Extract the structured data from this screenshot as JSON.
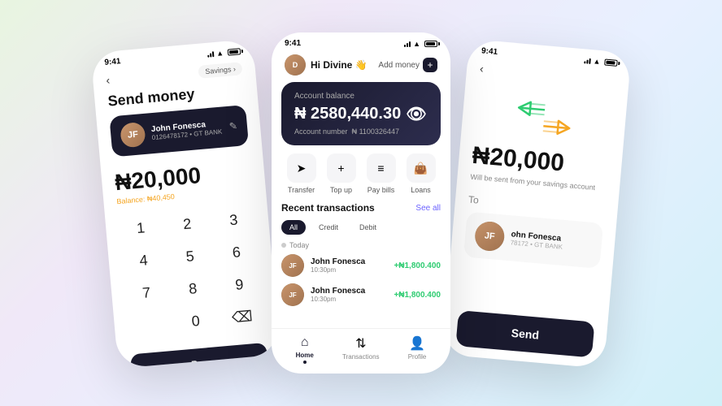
{
  "left_phone": {
    "status_time": "9:41",
    "header": {
      "back": "‹",
      "savings": "Savings ›"
    },
    "title": "Send money",
    "recipient": {
      "name": "John Fonesca",
      "account": "0126478172 • GT BANK",
      "initials": "JF"
    },
    "amount": "₦20,000",
    "balance": "Balance: ₦40,450",
    "numpad": [
      "1",
      "2",
      "3",
      "4",
      "5",
      "6",
      "7",
      "8",
      "9",
      "",
      "0",
      "⌫"
    ],
    "bottom_btn": "Pro"
  },
  "mid_phone": {
    "status_time": "9:41",
    "header": {
      "greeting": "Hi Divine 👋",
      "add_money": "Add money",
      "user_initials": "D"
    },
    "balance_card": {
      "label": "Account balance",
      "amount": "₦ 2580,440.30",
      "eye_icon": "👁",
      "account_label": "Account number",
      "account_number": "₦ 1100326447"
    },
    "actions": [
      {
        "icon": "➤",
        "label": "Transfer"
      },
      {
        "icon": "+",
        "label": "Top up"
      },
      {
        "icon": "≡",
        "label": "Pay bills"
      },
      {
        "icon": "👜",
        "label": "Loans"
      }
    ],
    "transactions": {
      "title": "Recent transactions",
      "see_all": "See all",
      "filters": [
        "All",
        "Credit",
        "Debit"
      ],
      "active_filter": "All",
      "date_label": "Today",
      "items": [
        {
          "name": "John Fonesca",
          "time": "10:30pm",
          "amount": "+₦1,800.400",
          "initials": "JF"
        },
        {
          "name": "John Fonesca",
          "time": "10:30pm",
          "amount": "+₦1,800.400",
          "initials": "JF"
        }
      ]
    },
    "nav": [
      {
        "icon": "⌂",
        "label": "Home",
        "active": true
      },
      {
        "icon": "⇅",
        "label": "Transactions",
        "active": false
      },
      {
        "icon": "👤",
        "label": "Profile",
        "active": false
      }
    ]
  },
  "right_phone": {
    "status_time": "9:41",
    "back": "‹",
    "amount": "₦20,000",
    "sub_text": "Will be sent from your savings account",
    "to_label": "To",
    "recipient": {
      "name": "ohn Fonesca",
      "account": "78172 • GT BANK",
      "initials": "JF"
    },
    "send_btn": "Send"
  }
}
